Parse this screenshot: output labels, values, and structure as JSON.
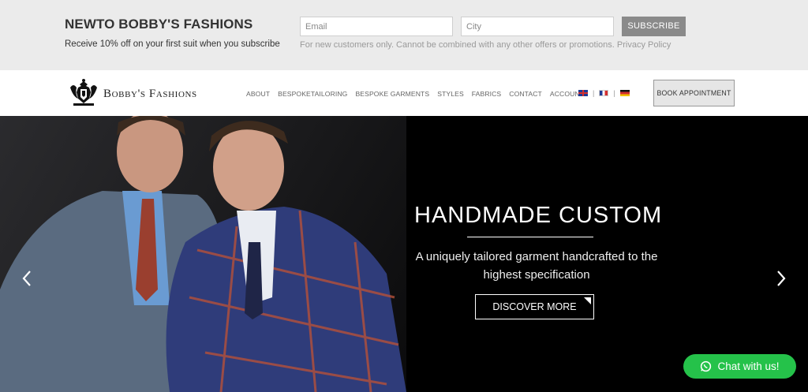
{
  "subscribe": {
    "title": "NEWTO BOBBY'S FASHIONS",
    "text": "Receive 10% off on your first suit when you subscribe",
    "email_placeholder": "Email",
    "city_placeholder": "City",
    "button_label": "SUBSCRIBE",
    "fine_print": "For new customers only. Cannot be combined with any other offers or promotions. Privacy Policy"
  },
  "header": {
    "logo_text": "Bobby's Fashions",
    "nav": [
      {
        "label": "ABOUT"
      },
      {
        "label": "BESPOKETAILORING"
      },
      {
        "label": "BESPOKE GARMENTS"
      },
      {
        "label": "STYLES"
      },
      {
        "label": "FABRICS"
      },
      {
        "label": "CONTACT"
      },
      {
        "label": "ACCOUNT"
      }
    ],
    "languages": [
      "uk-flag-icon",
      "fr-flag-icon",
      "de-flag-icon"
    ],
    "book_label": "BOOK APPOINTMENT"
  },
  "hero": {
    "title": "HANDMADE CUSTOM",
    "subtitle": "A uniquely tailored garment handcrafted to the highest specification",
    "button_label": "DISCOVER MORE",
    "prev_icon": "chevron-left-icon",
    "next_icon": "chevron-right-icon"
  },
  "chat": {
    "label": "Chat with us!",
    "icon": "whatsapp-icon",
    "color": "#25c24a"
  }
}
